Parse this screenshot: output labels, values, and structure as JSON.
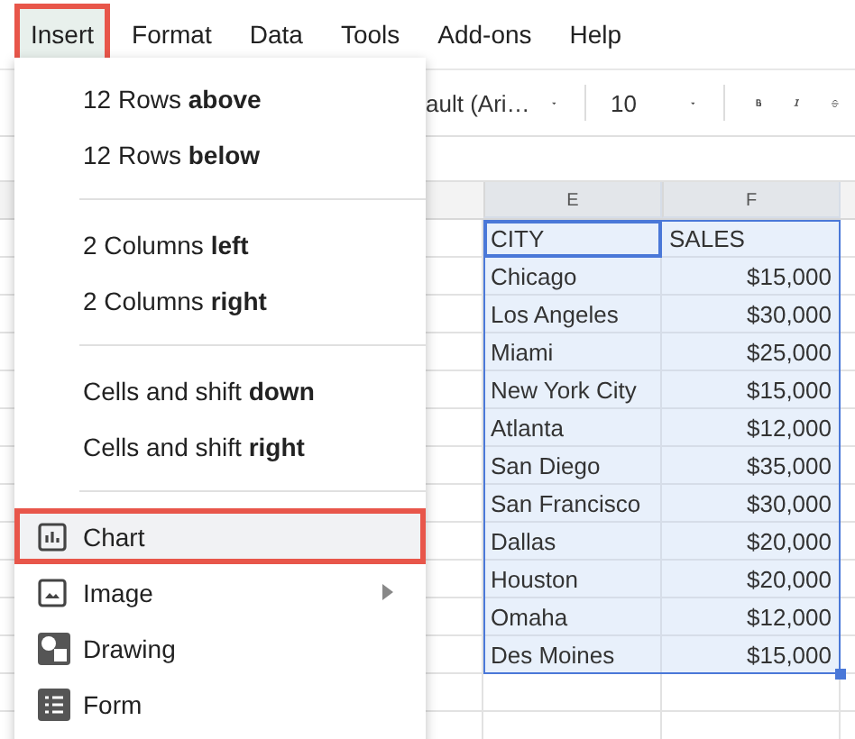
{
  "menu_bar": [
    {
      "label": "Insert",
      "selected": true
    },
    {
      "label": "Format",
      "selected": false
    },
    {
      "label": "Data",
      "selected": false
    },
    {
      "label": "Tools",
      "selected": false
    },
    {
      "label": "Add-ons",
      "selected": false
    },
    {
      "label": "Help",
      "selected": false
    }
  ],
  "toolbar": {
    "font": "ault (Ari…",
    "font_size": "10"
  },
  "sheet": {
    "columns": [
      "E",
      "F"
    ],
    "rows": [
      [
        "CITY",
        "SALES"
      ],
      [
        "Chicago",
        "$15,000"
      ],
      [
        "Los Angeles",
        "$30,000"
      ],
      [
        "Miami",
        "$25,000"
      ],
      [
        "New York City",
        "$15,000"
      ],
      [
        "Atlanta",
        "$12,000"
      ],
      [
        "San Diego",
        "$35,000"
      ],
      [
        "San Francisco",
        "$30,000"
      ],
      [
        "Dallas",
        "$20,000"
      ],
      [
        "Houston",
        "$20,000"
      ],
      [
        "Omaha",
        "$12,000"
      ],
      [
        "Des Moines",
        "$15,000"
      ]
    ]
  },
  "menu": {
    "items": [
      {
        "kind": "item",
        "label": "12 Rows **above**",
        "highlighted": false
      },
      {
        "kind": "item",
        "label": "12 Rows **below**",
        "highlighted": false
      },
      {
        "kind": "separator"
      },
      {
        "kind": "item",
        "label": "2 Columns **left**",
        "highlighted": false
      },
      {
        "kind": "item",
        "label": "2 Columns **right**",
        "highlighted": false
      },
      {
        "kind": "separator"
      },
      {
        "kind": "item",
        "label": "Cells and shift **down**",
        "highlighted": false
      },
      {
        "kind": "item",
        "label": "Cells and shift **right**",
        "highlighted": false
      },
      {
        "kind": "separator"
      },
      {
        "kind": "chart",
        "label": "Chart",
        "highlighted": true
      },
      {
        "kind": "image",
        "label": "Image",
        "submenu": true,
        "highlighted": false
      },
      {
        "kind": "drawing",
        "label": "Drawing",
        "highlighted": false
      },
      {
        "kind": "form",
        "label": "Form",
        "highlighted": false
      }
    ]
  }
}
